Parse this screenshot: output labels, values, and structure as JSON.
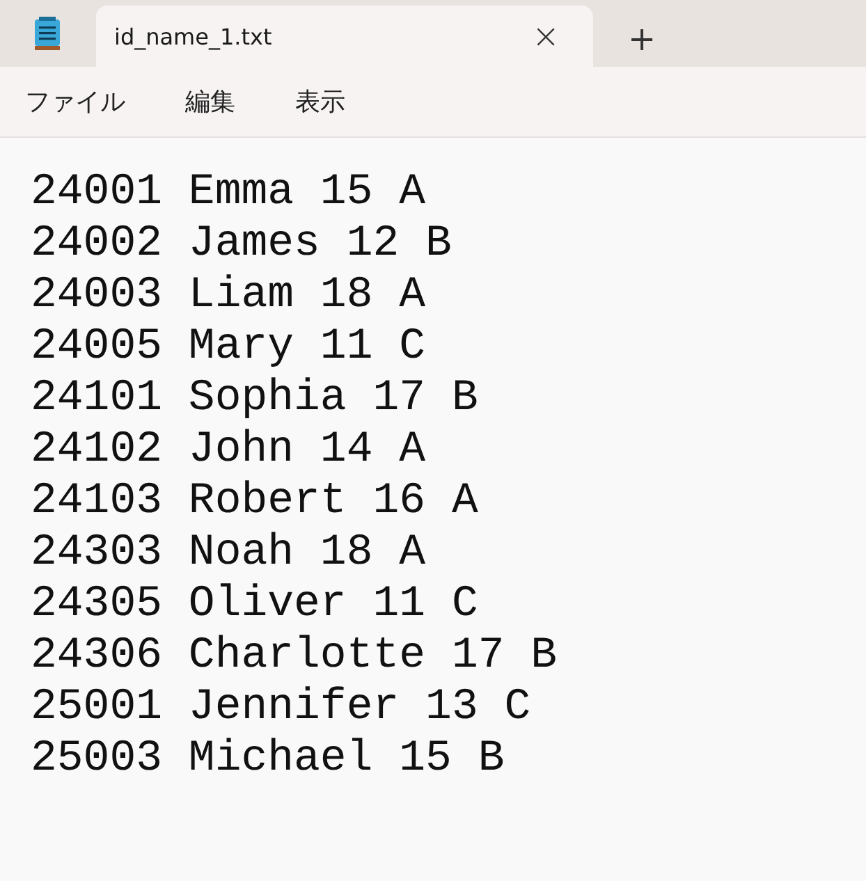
{
  "tabs": [
    {
      "label": "id_name_1.txt",
      "selected": true,
      "close": "×"
    }
  ],
  "new_tab": "+",
  "menu": [
    "ファイル",
    "編集",
    "表示"
  ],
  "lines": [
    "24001 Emma 15 A",
    "24002 James 12 B",
    "24003 Liam 18 A",
    "24005 Mary 11 C",
    "24101 Sophia 17 B",
    "24102 John 14 A",
    "24103 Robert 16 A",
    "24303 Noah 18 A",
    "24305 Oliver 11 C",
    "24306 Charlotte 17 B",
    "25001 Jennifer 13 C",
    "25003 Michael 15 B"
  ]
}
